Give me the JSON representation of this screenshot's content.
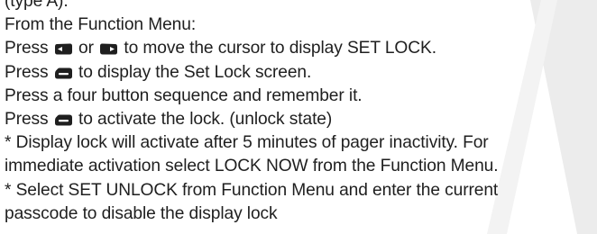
{
  "document": {
    "cropped_top_line": "(type A).",
    "heading": "From the Function Menu:",
    "steps": [
      {
        "before": "Press ",
        "icon_left": "left-button-icon",
        "middle": " or ",
        "icon_right": "right-button-icon",
        "after": " to move the cursor to display SET LOCK."
      },
      {
        "before": "Press ",
        "icon": "enter-button-icon",
        "after": " to display the Set Lock screen."
      },
      {
        "text": "Press a four button sequence and remember it."
      },
      {
        "before": "Press ",
        "icon": "enter-button-icon",
        "after": " to activate the lock. (unlock state)"
      }
    ],
    "notes": [
      "* Display lock will activate after 5 minutes of pager inactivity. For",
      "immediate activation select LOCK NOW from the Function Menu.",
      "* Select SET UNLOCK from Function Menu and enter the current",
      "passcode to disable the display lock"
    ]
  },
  "colors": {
    "text": "#1f1f1f",
    "background": "#ffffff",
    "decor_band": "#e9e9e9"
  }
}
